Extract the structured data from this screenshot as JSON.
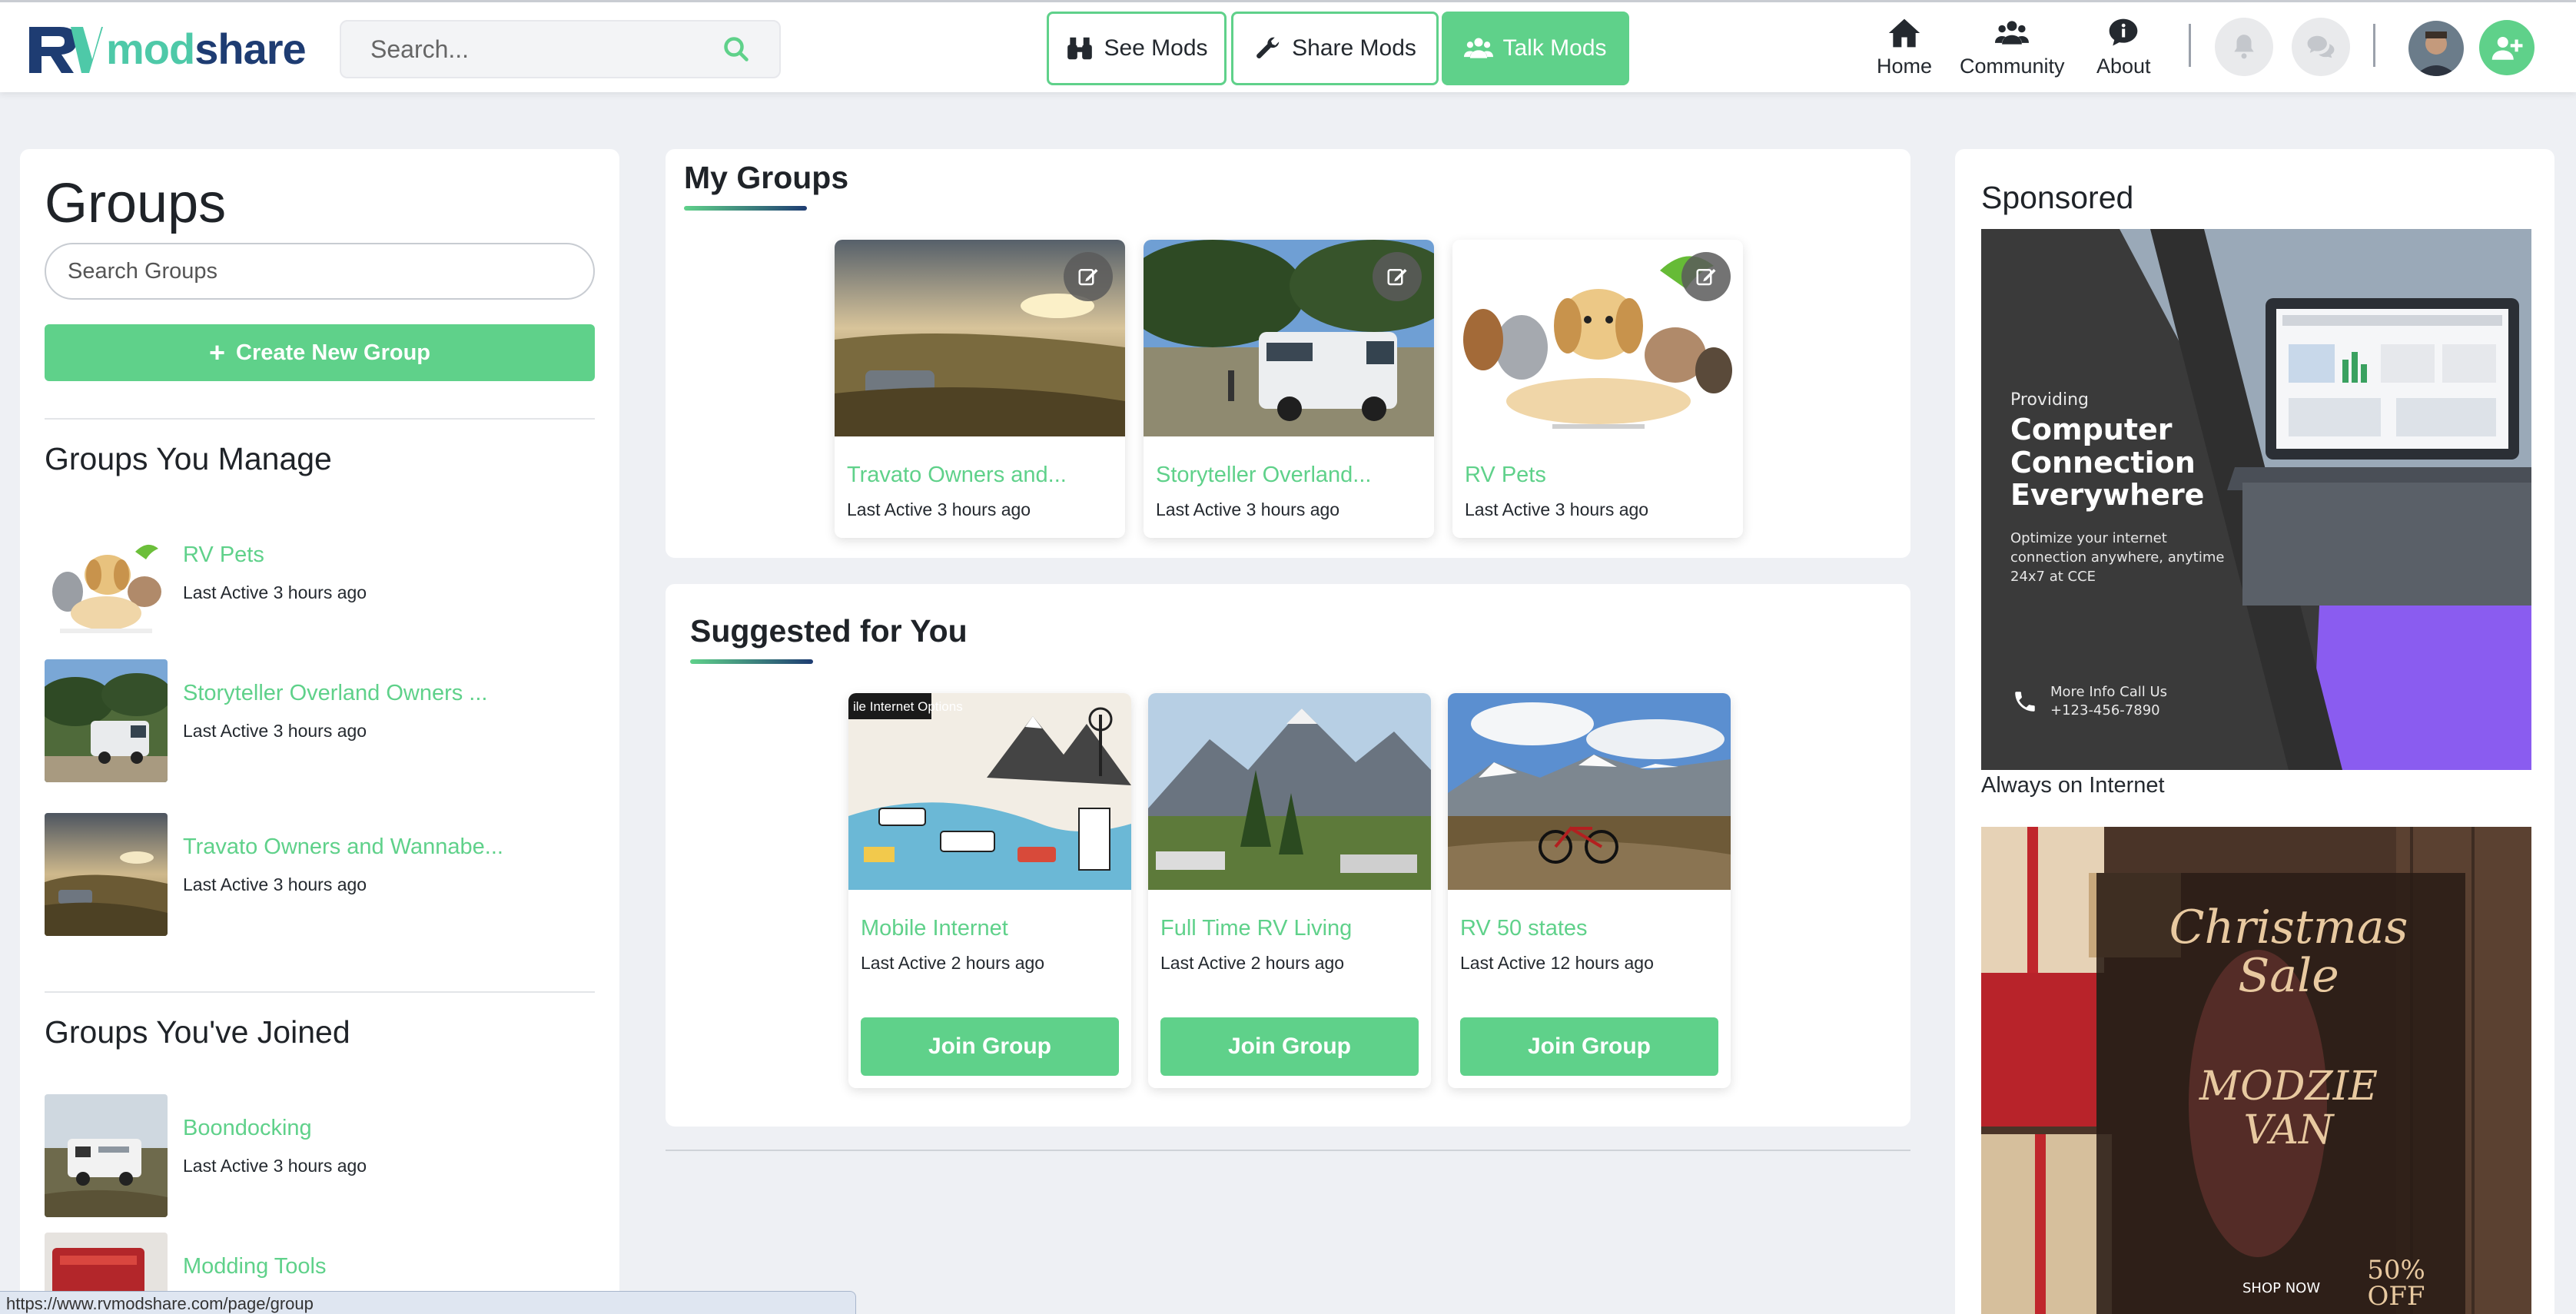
{
  "header": {
    "brand": "modshare",
    "search": {
      "placeholder": "Search..."
    },
    "nav_buttons": [
      {
        "label": "See Mods",
        "icon": "binoculars-icon",
        "active": false
      },
      {
        "label": "Share Mods",
        "icon": "wrench-icon",
        "active": false
      },
      {
        "label": "Talk Mods",
        "icon": "users-icon",
        "active": true
      }
    ],
    "nav_links": [
      {
        "label": "Home",
        "icon": "home-icon"
      },
      {
        "label": "Community",
        "icon": "community-icon"
      },
      {
        "label": "About",
        "icon": "info-bubble-icon"
      }
    ]
  },
  "left_panel": {
    "title": "Groups",
    "search_placeholder": "Search Groups",
    "create_label": "Create New Group",
    "manage_title": "Groups You Manage",
    "managed_groups": [
      {
        "name": "RV Pets",
        "meta": "Last Active 3 hours ago"
      },
      {
        "name": "Storyteller Overland Owners ...",
        "meta": "Last Active 3 hours ago"
      },
      {
        "name": "Travato Owners and Wannabe...",
        "meta": "Last Active 3 hours ago"
      }
    ],
    "joined_title": "Groups You've Joined",
    "joined_groups": [
      {
        "name": "Boondocking",
        "meta": "Last Active 3 hours ago"
      },
      {
        "name": "Modding Tools",
        "meta": ""
      }
    ]
  },
  "my_groups": {
    "title": "My Groups",
    "items": [
      {
        "name": "Travato Owners and...",
        "meta": "Last Active 3 hours ago"
      },
      {
        "name": "Storyteller Overland...",
        "meta": "Last Active 3 hours ago"
      },
      {
        "name": "RV Pets",
        "meta": "Last Active 3 hours ago"
      }
    ]
  },
  "suggested": {
    "title": "Suggested for You",
    "join_label": "Join Group",
    "items": [
      {
        "name": "Mobile Internet",
        "meta": "Last Active 2 hours ago",
        "image_text": "ile Internet Options"
      },
      {
        "name": "Full Time RV Living",
        "meta": "Last Active 2 hours ago"
      },
      {
        "name": "RV 50 states",
        "meta": "Last Active 12 hours ago"
      }
    ]
  },
  "sponsored": {
    "title": "Sponsored",
    "ad1": {
      "eyebrow": "Providing",
      "headline": "Computer Connection Everywhere",
      "body": "Optimize your internet connection anywhere, anytime 24x7  at CCE",
      "contact_label": "More Info Call Us",
      "phone": "+123-456-7890",
      "caption": "Always on Internet"
    },
    "ad2": {
      "script": "Christmas Sale",
      "brand": "MODZIE VAN",
      "cta": "SHOP NOW",
      "discount": "50% OFF"
    }
  },
  "status_url": "https://www.rvmodshare.com/page/group",
  "colors": {
    "accent": "#5fd18a",
    "brand_dark": "#1e3c72",
    "brand_teal": "#4ec9a8"
  }
}
